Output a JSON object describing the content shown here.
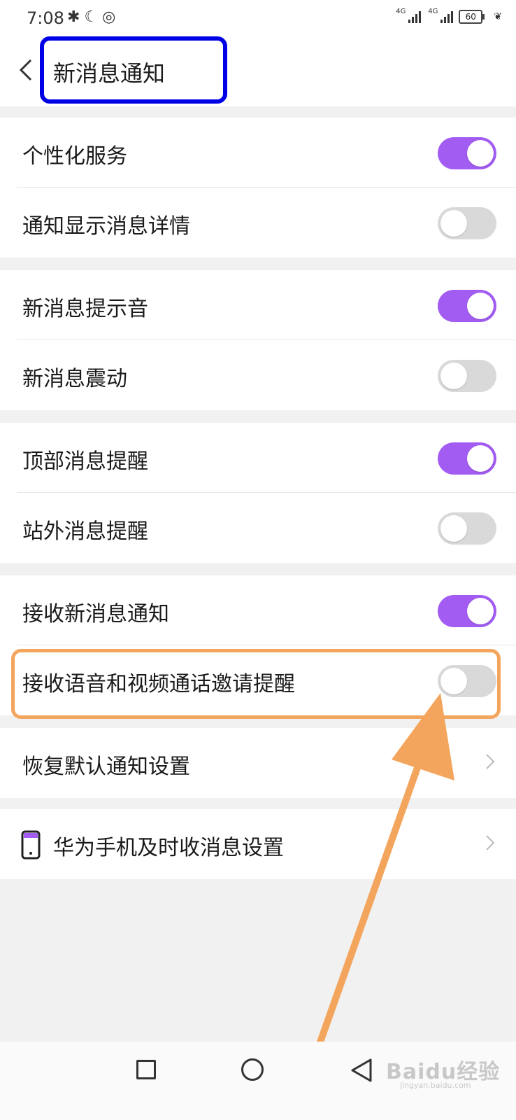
{
  "status_bar": {
    "time": "7:08",
    "signal1_label": "4G",
    "signal2_label": "4G",
    "battery": "60"
  },
  "header": {
    "title": "新消息通知"
  },
  "groups": [
    {
      "items": [
        {
          "label": "个性化服务",
          "toggle": "on"
        },
        {
          "label": "通知显示消息详情",
          "toggle": "off"
        }
      ]
    },
    {
      "items": [
        {
          "label": "新消息提示音",
          "toggle": "on"
        },
        {
          "label": "新消息震动",
          "toggle": "off"
        }
      ]
    },
    {
      "items": [
        {
          "label": "顶部消息提醒",
          "toggle": "on"
        },
        {
          "label": "站外消息提醒",
          "toggle": "off"
        }
      ]
    },
    {
      "items": [
        {
          "label": "接收新消息通知",
          "toggle": "on"
        },
        {
          "label": "接收语音和视频通话邀请提醒",
          "toggle": "off"
        }
      ]
    }
  ],
  "restore": {
    "label": "恢复默认通知设置"
  },
  "huawei": {
    "label": "华为手机及时收消息设置"
  },
  "watermark": {
    "main": "Baidu经验",
    "sub": "jingyan.baidu.com"
  },
  "colors": {
    "toggle_on": "#a25cf2",
    "toggle_off": "#d9d9d9",
    "title_highlight": "#0000e6",
    "annotation_orange": "#f4a55d"
  }
}
